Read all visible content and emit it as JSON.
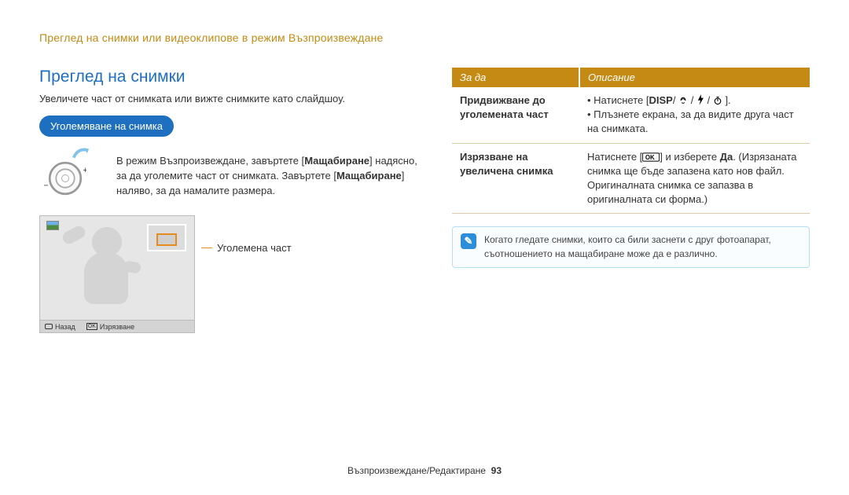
{
  "breadcrumb": "Преглед на снимки или видеоклипове в режим Възпроизвеждане",
  "h2": "Преглед на снимки",
  "intro": "Увеличете част от снимката или вижте снимките като слайдшоу.",
  "pill": "Уголемяване на снимка",
  "dialText": {
    "plain1": "В режим Възпроизвеждане, завъртете [",
    "bold1": "Мащабиране",
    "plain2": "] надясно, за да уголемите част от снимката. Завъртете [",
    "bold2": "Мащабиране",
    "plain3": "] наляво, за да намалите размера."
  },
  "bar": {
    "back": "Назад",
    "ok": "Изрязване"
  },
  "callout": "Уголемена част",
  "table": {
    "head1": "За да",
    "head2": "Описание",
    "rows": [
      {
        "a": "Придвижване до уголемената част",
        "b": {
          "li1pre": "Натиснете [",
          "li1key": "DISP",
          "li1mid": "/",
          "li1post": "].",
          "li2": "Плъзнете екрана, за да видите друга част на снимката."
        }
      },
      {
        "a": "Изрязване на увеличена снимка",
        "bplain1": "Натиснете [",
        "bplain2": "] и изберете ",
        "bbold": "Да",
        "bplain3": ". (Изрязаната снимка ще бъде запазена като нов файл. Оригиналната снимка се запазва в оригиналната си форма.)"
      }
    ]
  },
  "note": "Когато гледате снимки, които са били заснети с друг фотоапарат, съотношението на мащабиране може да е различно.",
  "footer": {
    "label": "Възпроизвеждане/Редактиране",
    "page": "93"
  }
}
